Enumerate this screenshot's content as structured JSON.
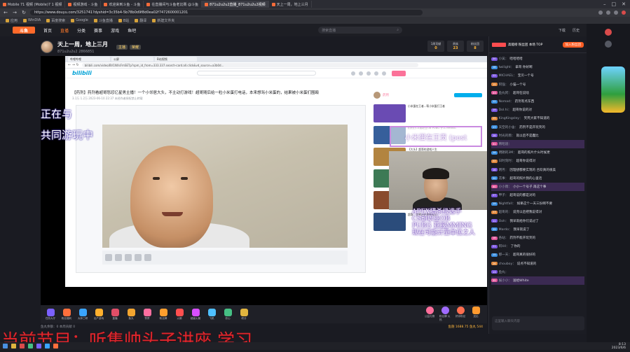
{
  "browser": {
    "tabs": [
      {
        "label": "Mobile 71 视频 (Mobile)7 1 视频"
      },
      {
        "label": "视频游戏 - 斗鱼"
      },
      {
        "label": "欢迎来到斗鱼 - 斗鱼"
      },
      {
        "label": "在直播间与斗鱼老比赛 @斗鱼"
      },
      {
        "label": "871u2u2u2直播_871u2u2u2视频"
      },
      {
        "label": "天上一周，地上三月"
      }
    ],
    "url": "https://www.douyu.com/3251741?dyshid=3c35b4-5b78b0d9f8d0ea02f7472600001201",
    "bookmarks": [
      "应用",
      "WinDIA",
      "百度搜索",
      "Google",
      "斗鱼直播",
      "B站",
      "翻译",
      "新建文件夹"
    ]
  },
  "douyu": {
    "logo": "斗鱼",
    "nav": [
      "首页",
      "直播",
      "分类",
      "赛事",
      "游戏",
      "鱼吧"
    ],
    "search_placeholder": "搜索直播",
    "right": [
      "下载",
      "历史",
      "关注",
      "消息",
      "开播"
    ]
  },
  "room": {
    "title": "天上一周，地上三月",
    "sub": "871u2u2u2",
    "room_no": "2866851",
    "badges": [
      "主播",
      "荣耀"
    ],
    "stats": [
      {
        "label": "1周贡献",
        "value": "0"
      },
      {
        "label": "贵族",
        "value": "23"
      },
      {
        "label": "粉丝团",
        "value": "8"
      }
    ]
  },
  "inner": {
    "tabs": [
      "哔哩哔哩",
      "公屏",
      "B站视频"
    ],
    "url": "bilibili.com/video/BV1NXsFmSETp?spm_id_from=333.337.search-card.all.click&vd_source=a3b0d...",
    "logo": "bilibili",
    "video_title": "【药剂】药剂看超哥怒怼亿星男主播！一个小邻居大头，不主动打游戏！超哥随后给一粒小米蛋打电话，本来想骂小米蛋的，结果被小米蛋们围殴",
    "video_sub": "3.1万  1.2万  2023-06-10 22:37  未经作者授权禁止转载",
    "up_name": "药剂",
    "rec": [
      {
        "text": "小米蛋在王者...帮小米蛋打王者",
        "color": "#6a4bb3"
      },
      {
        "text": "药剂打CS前职业OB PUBG 什么 MMING",
        "color": "#365f9b"
      },
      {
        "text": "【大头】超哥的游戏人生",
        "color": "#b28440"
      },
      {
        "text": "我是谁也有人生么，去吃饭了",
        "color": "#3d7a55"
      },
      {
        "text": "【大头】哥：退役后的第一次直播",
        "color": "#894b2d"
      },
      {
        "text": "超哥：世界冠军的朋友们",
        "color": "#2b4c7b"
      }
    ]
  },
  "overlay": {
    "left_line1": "正在与",
    "left_line2": "共同游玩中",
    "banner": "小米蛋在王贡 (post",
    "right_line1": "APEX猎杀级选手",
    "right_line2": "CS前职业OB",
    "right_line3": "PUBG 亚服MMING",
    "right_line4": "现在可能计量单位之人"
  },
  "gifts": [
    {
      "label": "任务大厅",
      "color": "#7b61ff"
    },
    {
      "label": "粉丝福利",
      "color": "#ff6f3c"
    },
    {
      "label": "大师三峡",
      "color": "#3aa5ff"
    },
    {
      "label": "出产游戏",
      "color": "#ffb02e"
    },
    {
      "label": "直播",
      "color": "#e04e67"
    },
    {
      "label": "鱼丸",
      "color": "#f3a530"
    },
    {
      "label": "赞赞",
      "color": "#ff6fa0"
    },
    {
      "label": "粉丝牌",
      "color": "#ff9f2e"
    },
    {
      "label": "火箭",
      "color": "#ff4f4f"
    },
    {
      "label": "超级火箭",
      "color": "#d74fff"
    },
    {
      "label": "飞机",
      "color": "#4fc0ff"
    },
    {
      "label": "初心",
      "color": "#46c084"
    },
    {
      "label": "积分",
      "color": "#e0b43f"
    }
  ],
  "gift_right": [
    {
      "label": "公益礼物",
      "color": "#ff6e9b"
    },
    {
      "label": "粉丝牌 火热",
      "color": "#a06bff"
    },
    {
      "label": "好评粉丝",
      "color": "#ff6e4f"
    },
    {
      "label": "送出",
      "color": "#ff9a2f"
    }
  ],
  "below": {
    "left": "鱼丸余额：0  本周贡献 0",
    "coin": "鱼翅 1688.75   鱼丸 544"
  },
  "program": "当前节目：听集帅头子讲座 学习",
  "chat": {
    "tab": "贵宾(8)",
    "title": "高能榜  粉丝团 本场 TOP",
    "join": "加入粉丝团",
    "messages": [
      {
        "lv": "20",
        "color": "#7a55e0",
        "user": "小吴：",
        "text": "哈哈哈哈",
        "hl": false
      },
      {
        "lv": "18",
        "color": "#3b8fe0",
        "user": "twilight：",
        "text": "拿哥 你好啊",
        "hl": false
      },
      {
        "lv": "22",
        "color": "#7a55e0",
        "user": "MICHAEL：",
        "text": "宝贝一个号",
        "hl": false
      },
      {
        "lv": "15",
        "color": "#e0873b",
        "user": "阿强：",
        "text": "小猫一个号",
        "hl": false
      },
      {
        "lv": "33",
        "color": "#e05599",
        "user": "鱼丸阿：",
        "text": "超哥在说啥",
        "hl": false
      },
      {
        "lv": "12",
        "color": "#3b8fe0",
        "user": "Nomad：",
        "text": "药剂有点东西",
        "hl": false
      },
      {
        "lv": "19",
        "color": "#7a55e0",
        "user": "Dol.hi：",
        "text": "超哥你说的对",
        "hl": false
      },
      {
        "lv": "25",
        "color": "#e0873b",
        "user": "KingKingsley：",
        "text": "笑死大家不知道的",
        "hl": false
      },
      {
        "lv": "17",
        "color": "#3b8fe0",
        "user": "天空的小舍：",
        "text": "药剂不是开玩笑的",
        "hl": false
      },
      {
        "lv": "28",
        "color": "#7a55e0",
        "user": "时光的雨：",
        "text": "就以后不是蠢比",
        "hl": false
      },
      {
        "lv": "31",
        "color": "#e05599",
        "user": "韩昭道：",
        "text": "",
        "hl": true
      },
      {
        "lv": "14",
        "color": "#3b8fe0",
        "user": "明朗的3M：",
        "text": "超哥的照片什么时候更",
        "hl": false
      },
      {
        "lv": "22",
        "color": "#e0873b",
        "user": "日时刻时：",
        "text": "超哥你说得对",
        "hl": false
      },
      {
        "lv": "16",
        "color": "#7a55e0",
        "user": "明月：",
        "text": "因理想都要实现的 合欢真的很美",
        "hl": false
      },
      {
        "lv": "20",
        "color": "#3b8fe0",
        "user": "花事：",
        "text": "超哥的照片我的心里话",
        "hl": false
      },
      {
        "lv": "40",
        "color": "#e05599",
        "user": "小小雨：",
        "text": "小小一个号子 再这个事",
        "hl": true
      },
      {
        "lv": "27",
        "color": "#7a55e0",
        "user": "甲子：",
        "text": "超哥说的都是对的",
        "hl": false
      },
      {
        "lv": "19",
        "color": "#3b8fe0",
        "user": "Nightfall：",
        "text": "如果这个一天三份啊不要",
        "hl": false
      },
      {
        "lv": "23",
        "color": "#e0873b",
        "user": "超哥的：",
        "text": "说完以后把我说得对",
        "hl": false
      },
      {
        "lv": "11",
        "color": "#7a55e0",
        "user": "Ooh：",
        "text": "我早就给你们说过了",
        "hl": false
      },
      {
        "lv": "29",
        "color": "#3b8fe0",
        "user": "Mardo：",
        "text": "我早就说了",
        "hl": false
      },
      {
        "lv": "18",
        "color": "#e05599",
        "user": "各站：",
        "text": "药剂不能开玩笑的",
        "hl": false
      },
      {
        "lv": "21",
        "color": "#7a55e0",
        "user": "阿44：",
        "text": "了你的",
        "hl": false
      },
      {
        "lv": "15",
        "color": "#3b8fe0",
        "user": "那一天：",
        "text": "超哥真的很好的",
        "hl": false
      },
      {
        "lv": "26",
        "color": "#e0873b",
        "user": "chouboy：",
        "text": "说点不知道的",
        "hl": false
      },
      {
        "lv": "13",
        "color": "#7a55e0",
        "user": "鱼丸：",
        "text": "",
        "hl": false
      },
      {
        "lv": "35",
        "color": "#e05599",
        "user": "娱小小：",
        "text": "送给White",
        "hl": true
      }
    ],
    "input_placeholder": "这里输入聊天内容"
  },
  "taskbar": {
    "time": "8:13",
    "date": "2023/6/6"
  }
}
